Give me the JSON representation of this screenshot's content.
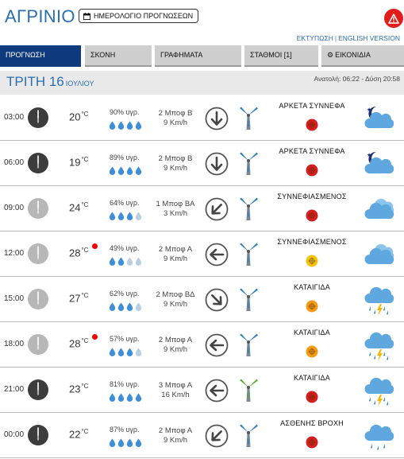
{
  "header": {
    "city": "ΑΓΡΙΝΙΟ",
    "calendar_button": "ΗΜΕΡΟΛΟΓΙΟ ΠΡΟΓΝΩΣΕΩΝ",
    "print_link": "ΕΚΤΥΠΩΣΗ",
    "english_link": "ENGLISH VERSION",
    "alert_color": "#e21b1b"
  },
  "tabs": [
    {
      "label": "ΠΡΟΓΝΩΣΗ",
      "active": true
    },
    {
      "label": "ΣΚΟΝΗ",
      "active": false
    },
    {
      "label": "ΓΡΑΦΗΜΑΤΑ",
      "active": false
    },
    {
      "label": "ΣΤΑΘΜΟΙ [1]",
      "active": false
    },
    {
      "label": "ΕΙΚΟΝΙΔΙΑ",
      "active": false
    }
  ],
  "day": {
    "name": "ΤΡΙΤΗ 16",
    "month": "ΙΟΥΛΙΟΥ",
    "sunrise": "Ανατολή: 06:22 - Δύση 20:58"
  },
  "colors": {
    "accent": "#2a6fb0",
    "active_tab": "#0f3a7d",
    "drop": "#3f8fd8",
    "drop_empty": "#b9cfe3",
    "severity_red": "#d31f1f",
    "severity_yellow": "#f1c40f",
    "severity_orange": "#f39c12"
  },
  "rows": [
    {
      "time": "03:00",
      "clock": "dark",
      "temp": "20",
      "unit": "°C",
      "hot": false,
      "humidity": "90% υγρ.",
      "drops": 4,
      "wind_bf": "2 Μποφ Β",
      "wind_kmh": "9 Km/h",
      "arrow": "down",
      "turbine": "blue",
      "condition": "ΑΡΚΕΤΑ ΣΥΝΝΕΦΑ",
      "severity": "red",
      "icon": "night-partly-cloudy-icon"
    },
    {
      "time": "06:00",
      "clock": "dark",
      "temp": "19",
      "unit": "°C",
      "hot": false,
      "humidity": "89% υγρ.",
      "drops": 4,
      "wind_bf": "2 Μποφ Β",
      "wind_kmh": "9 Km/h",
      "arrow": "down",
      "turbine": "blue",
      "condition": "ΑΡΚΕΤΑ ΣΥΝΝΕΦΑ",
      "severity": "red",
      "icon": "night-partly-cloudy-icon"
    },
    {
      "time": "09:00",
      "clock": "light",
      "temp": "24",
      "unit": "°C",
      "hot": false,
      "humidity": "64% υγρ.",
      "drops": 3,
      "wind_bf": "1 Μποφ ΒΑ",
      "wind_kmh": "3 Km/h",
      "arrow": "down-left",
      "turbine": "blue",
      "condition": "ΣΥΝΝΕΦΙΑΣΜΕΝΟΣ",
      "severity": "red",
      "icon": "cloudy-icon"
    },
    {
      "time": "12:00",
      "clock": "light",
      "temp": "28",
      "unit": "°C",
      "hot": true,
      "humidity": "49% υγρ.",
      "drops": 2,
      "wind_bf": "2 Μποφ Α",
      "wind_kmh": "9 Km/h",
      "arrow": "left",
      "turbine": "blue",
      "condition": "ΣΥΝΝΕΦΙΑΣΜΕΝΟΣ",
      "severity": "yellow",
      "icon": "cloudy-icon"
    },
    {
      "time": "15:00",
      "clock": "light",
      "temp": "27",
      "unit": "°C",
      "hot": false,
      "humidity": "62% υγρ.",
      "drops": 3,
      "wind_bf": "2 Μποφ ΒΔ",
      "wind_kmh": "9 Km/h",
      "arrow": "down-right",
      "turbine": "blue",
      "condition": "ΚΑΤΑΙΓΙΔΑ",
      "severity": "orange",
      "icon": "thunderstorm-icon"
    },
    {
      "time": "18:00",
      "clock": "light",
      "temp": "28",
      "unit": "°C",
      "hot": true,
      "humidity": "57% υγρ.",
      "drops": 3,
      "wind_bf": "2 Μποφ Α",
      "wind_kmh": "9 Km/h",
      "arrow": "left",
      "turbine": "blue",
      "condition": "ΚΑΤΑΙΓΙΔΑ",
      "severity": "orange",
      "icon": "thunderstorm-icon"
    },
    {
      "time": "21:00",
      "clock": "dark",
      "temp": "23",
      "unit": "°C",
      "hot": false,
      "humidity": "81% υγρ.",
      "drops": 4,
      "wind_bf": "3 Μποφ Α",
      "wind_kmh": "16 Km/h",
      "arrow": "left",
      "turbine": "green",
      "condition": "ΚΑΤΑΙΓΙΔΑ",
      "severity": "red",
      "icon": "thunderstorm-icon"
    },
    {
      "time": "00:00",
      "clock": "dark",
      "temp": "22",
      "unit": "°C",
      "hot": false,
      "humidity": "87% υγρ.",
      "drops": 4,
      "wind_bf": "2 Μποφ Α",
      "wind_kmh": "9 Km/h",
      "arrow": "down-left",
      "turbine": "blue",
      "condition": "ΑΣΘΕΝΗΣ ΒΡΟΧΗ",
      "severity": "red",
      "icon": "rain-icon"
    }
  ]
}
